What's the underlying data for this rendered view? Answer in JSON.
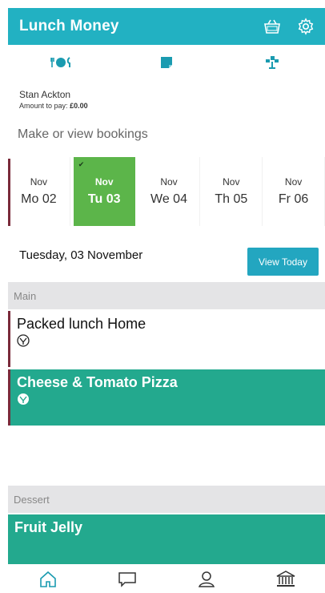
{
  "header": {
    "title": "Lunch Money",
    "icons": [
      "basket-icon",
      "settings-icon"
    ]
  },
  "topnav": {
    "items": [
      "meal-icon",
      "note-icon",
      "trophy-icon"
    ]
  },
  "user": {
    "name": "Stan Ackton",
    "amount_label": "Amount to pay:",
    "amount_value": "£0.00"
  },
  "bookings": {
    "heading": "Make or view bookings",
    "dates": [
      {
        "month": "Nov",
        "day": "Mo 02",
        "selected": false
      },
      {
        "month": "Nov",
        "day": "Tu 03",
        "selected": true
      },
      {
        "month": "Nov",
        "day": "We 04",
        "selected": false
      },
      {
        "month": "Nov",
        "day": "Th 05",
        "selected": false
      },
      {
        "month": "Nov",
        "day": "Fr 06",
        "selected": false
      }
    ]
  },
  "selected_date": "Tuesday, 03 November",
  "view_today_label": "View Today",
  "menu": {
    "main_label": "Main",
    "main_items": [
      {
        "name": "Packed lunch Home",
        "selected": false
      },
      {
        "name": "Cheese & Tomato Pizza",
        "selected": true
      }
    ],
    "dessert_label": "Dessert",
    "dessert_items": [
      {
        "name": "Fruit Jelly"
      }
    ]
  },
  "bottomnav": {
    "items": [
      "home-icon",
      "chat-icon",
      "profile-icon",
      "bank-icon"
    ]
  },
  "colors": {
    "header": "#22b1c2",
    "selected_date": "#5cb54a",
    "selected_meal": "#23a98e",
    "button": "#23a6c0"
  }
}
